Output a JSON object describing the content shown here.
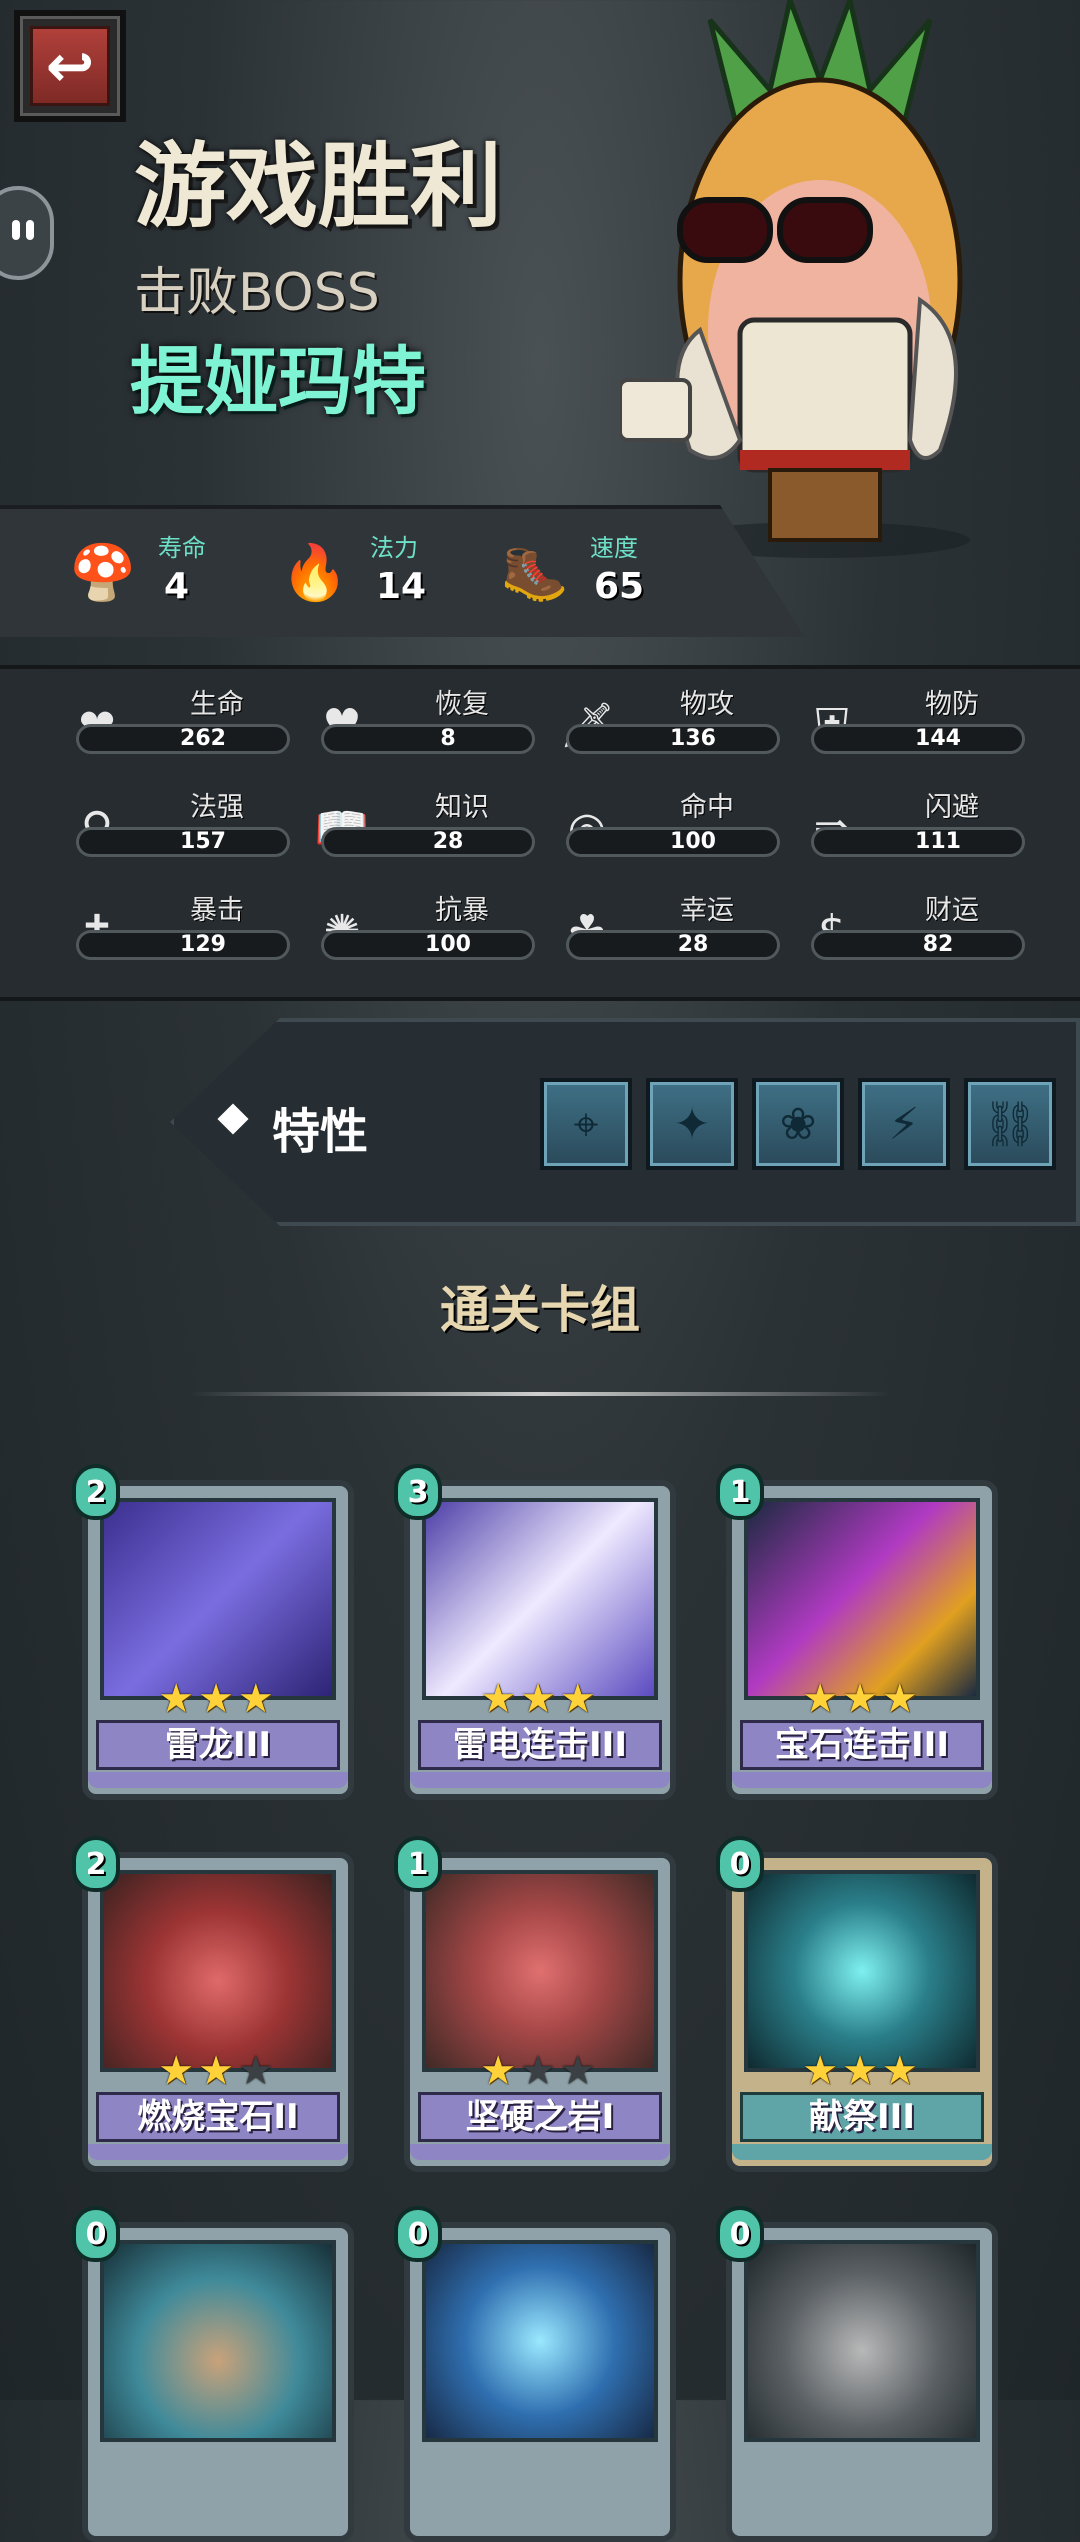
{
  "header": {
    "back_icon": "back-arrow-icon",
    "title": "游戏胜利",
    "subtitle": "击败BOSS",
    "boss_name": "提娅玛特"
  },
  "top_stats": [
    {
      "label": "寿命",
      "value": "4",
      "icon": "mushroom-head-icon"
    },
    {
      "label": "法力",
      "value": "14",
      "icon": "mana-flame-icon"
    },
    {
      "label": "速度",
      "value": "65",
      "icon": "winged-boot-icon"
    }
  ],
  "stats": [
    {
      "label": "生命",
      "value": "262",
      "icon": "heart-icon"
    },
    {
      "label": "恢复",
      "value": "8",
      "icon": "heal-heart-icon"
    },
    {
      "label": "物攻",
      "value": "136",
      "icon": "sword-icon"
    },
    {
      "label": "物防",
      "value": "144",
      "icon": "armor-icon"
    },
    {
      "label": "法强",
      "value": "157",
      "icon": "magic-staff-icon"
    },
    {
      "label": "知识",
      "value": "28",
      "icon": "book-icon"
    },
    {
      "label": "命中",
      "value": "100",
      "icon": "target-icon"
    },
    {
      "label": "闪避",
      "value": "111",
      "icon": "dodge-arrows-icon"
    },
    {
      "label": "暴击",
      "value": "129",
      "icon": "crit-sword-icon"
    },
    {
      "label": "抗暴",
      "value": "100",
      "icon": "shield-burst-icon"
    },
    {
      "label": "幸运",
      "value": "28",
      "icon": "clover-icon"
    },
    {
      "label": "财运",
      "value": "82",
      "icon": "coin-icon"
    }
  ],
  "traits": {
    "label": "特性",
    "items": [
      "target-rune-icon",
      "shard-icon",
      "rose-icon",
      "runner-icon",
      "chain-icon"
    ]
  },
  "deck": {
    "title": "通关卡组",
    "cards": [
      {
        "name": "雷龙III",
        "cost": "2",
        "stars": 3
      },
      {
        "name": "雷电连击III",
        "cost": "3",
        "stars": 3
      },
      {
        "name": "宝石连击III",
        "cost": "1",
        "stars": 3
      },
      {
        "name": "燃烧宝石II",
        "cost": "2",
        "stars": 2
      },
      {
        "name": "坚硬之岩I",
        "cost": "1",
        "stars": 1
      },
      {
        "name": "献祭III",
        "cost": "0",
        "stars": 3
      },
      {
        "name": "",
        "cost": "0",
        "stars": 0
      },
      {
        "name": "",
        "cost": "0",
        "stars": 0
      },
      {
        "name": "",
        "cost": "0",
        "stars": 0
      }
    ]
  },
  "colors": {
    "accent_teal": "#7ff4d4",
    "star_gold": "#ffd23a",
    "card_name_purple": "#8e86c4",
    "card_name_teal": "#5fa4a6"
  }
}
